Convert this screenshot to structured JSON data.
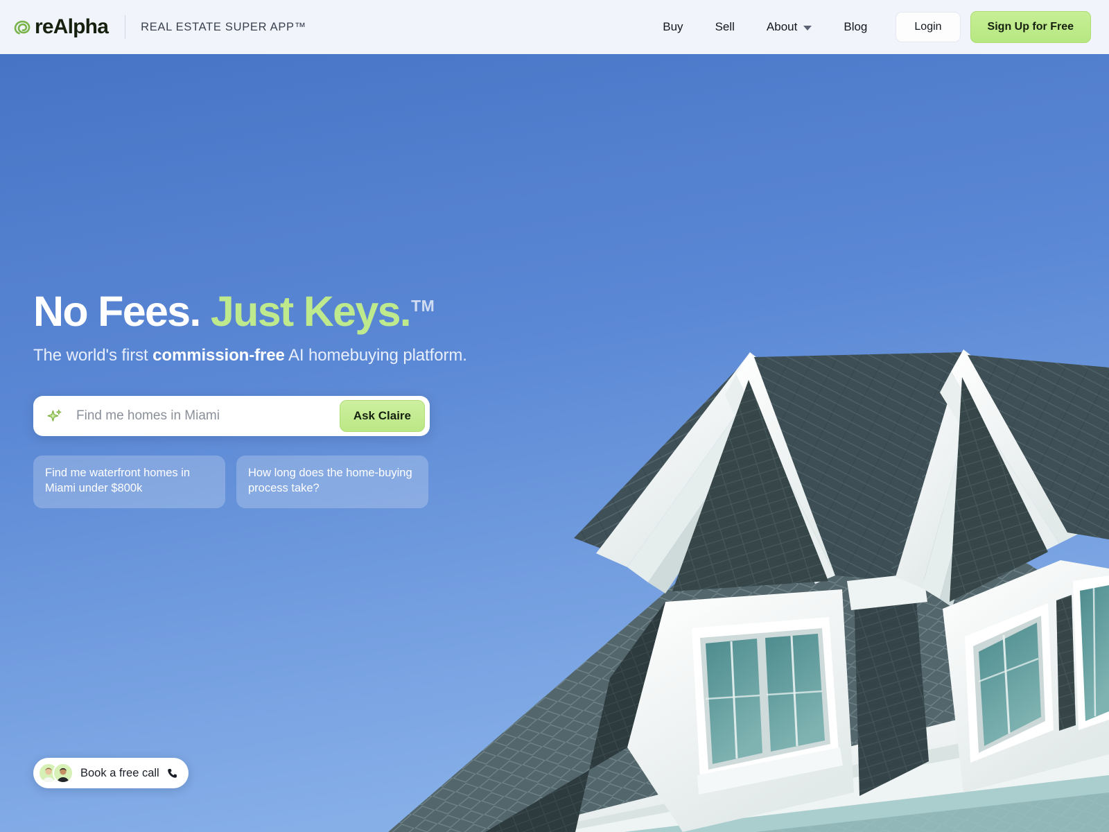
{
  "header": {
    "logo_word": "reAlpha",
    "logo_icon": "realpha-spiral-icon",
    "tagline": "REAL ESTATE SUPER APP™",
    "nav": [
      {
        "label": "Buy",
        "has_caret": false
      },
      {
        "label": "Sell",
        "has_caret": false
      },
      {
        "label": "About",
        "has_caret": true
      },
      {
        "label": "Blog",
        "has_caret": false
      }
    ],
    "login_label": "Login",
    "signup_label": "Sign Up for Free"
  },
  "hero": {
    "headline_part1": "No Fees.",
    "headline_part2": "Just Keys.",
    "headline_tm": "TM",
    "subhead_pre": "The world's first ",
    "subhead_bold": "commission-free",
    "subhead_post": " AI homebuying platform.",
    "search": {
      "icon": "sparkle-icon",
      "placeholder": "Find me homes in Miami",
      "value": "",
      "button_label": "Ask Claire"
    },
    "chips": [
      "Find me waterfront homes in Miami under $800k",
      "How long does the home-buying process take?"
    ]
  },
  "book_call": {
    "label": "Book a free call",
    "phone_icon": "phone-icon",
    "avatar_count": 2
  },
  "colors": {
    "brand_green": "#bbe785",
    "accent_green": "#bfe98d",
    "header_bg": "#f1f4fb",
    "sky_top": "#4874c6",
    "sky_bottom": "#83ace6",
    "roof_dark": "#3d4d4d",
    "trim_white": "#fbfcfb",
    "window_teal": "#4d8b8e"
  }
}
